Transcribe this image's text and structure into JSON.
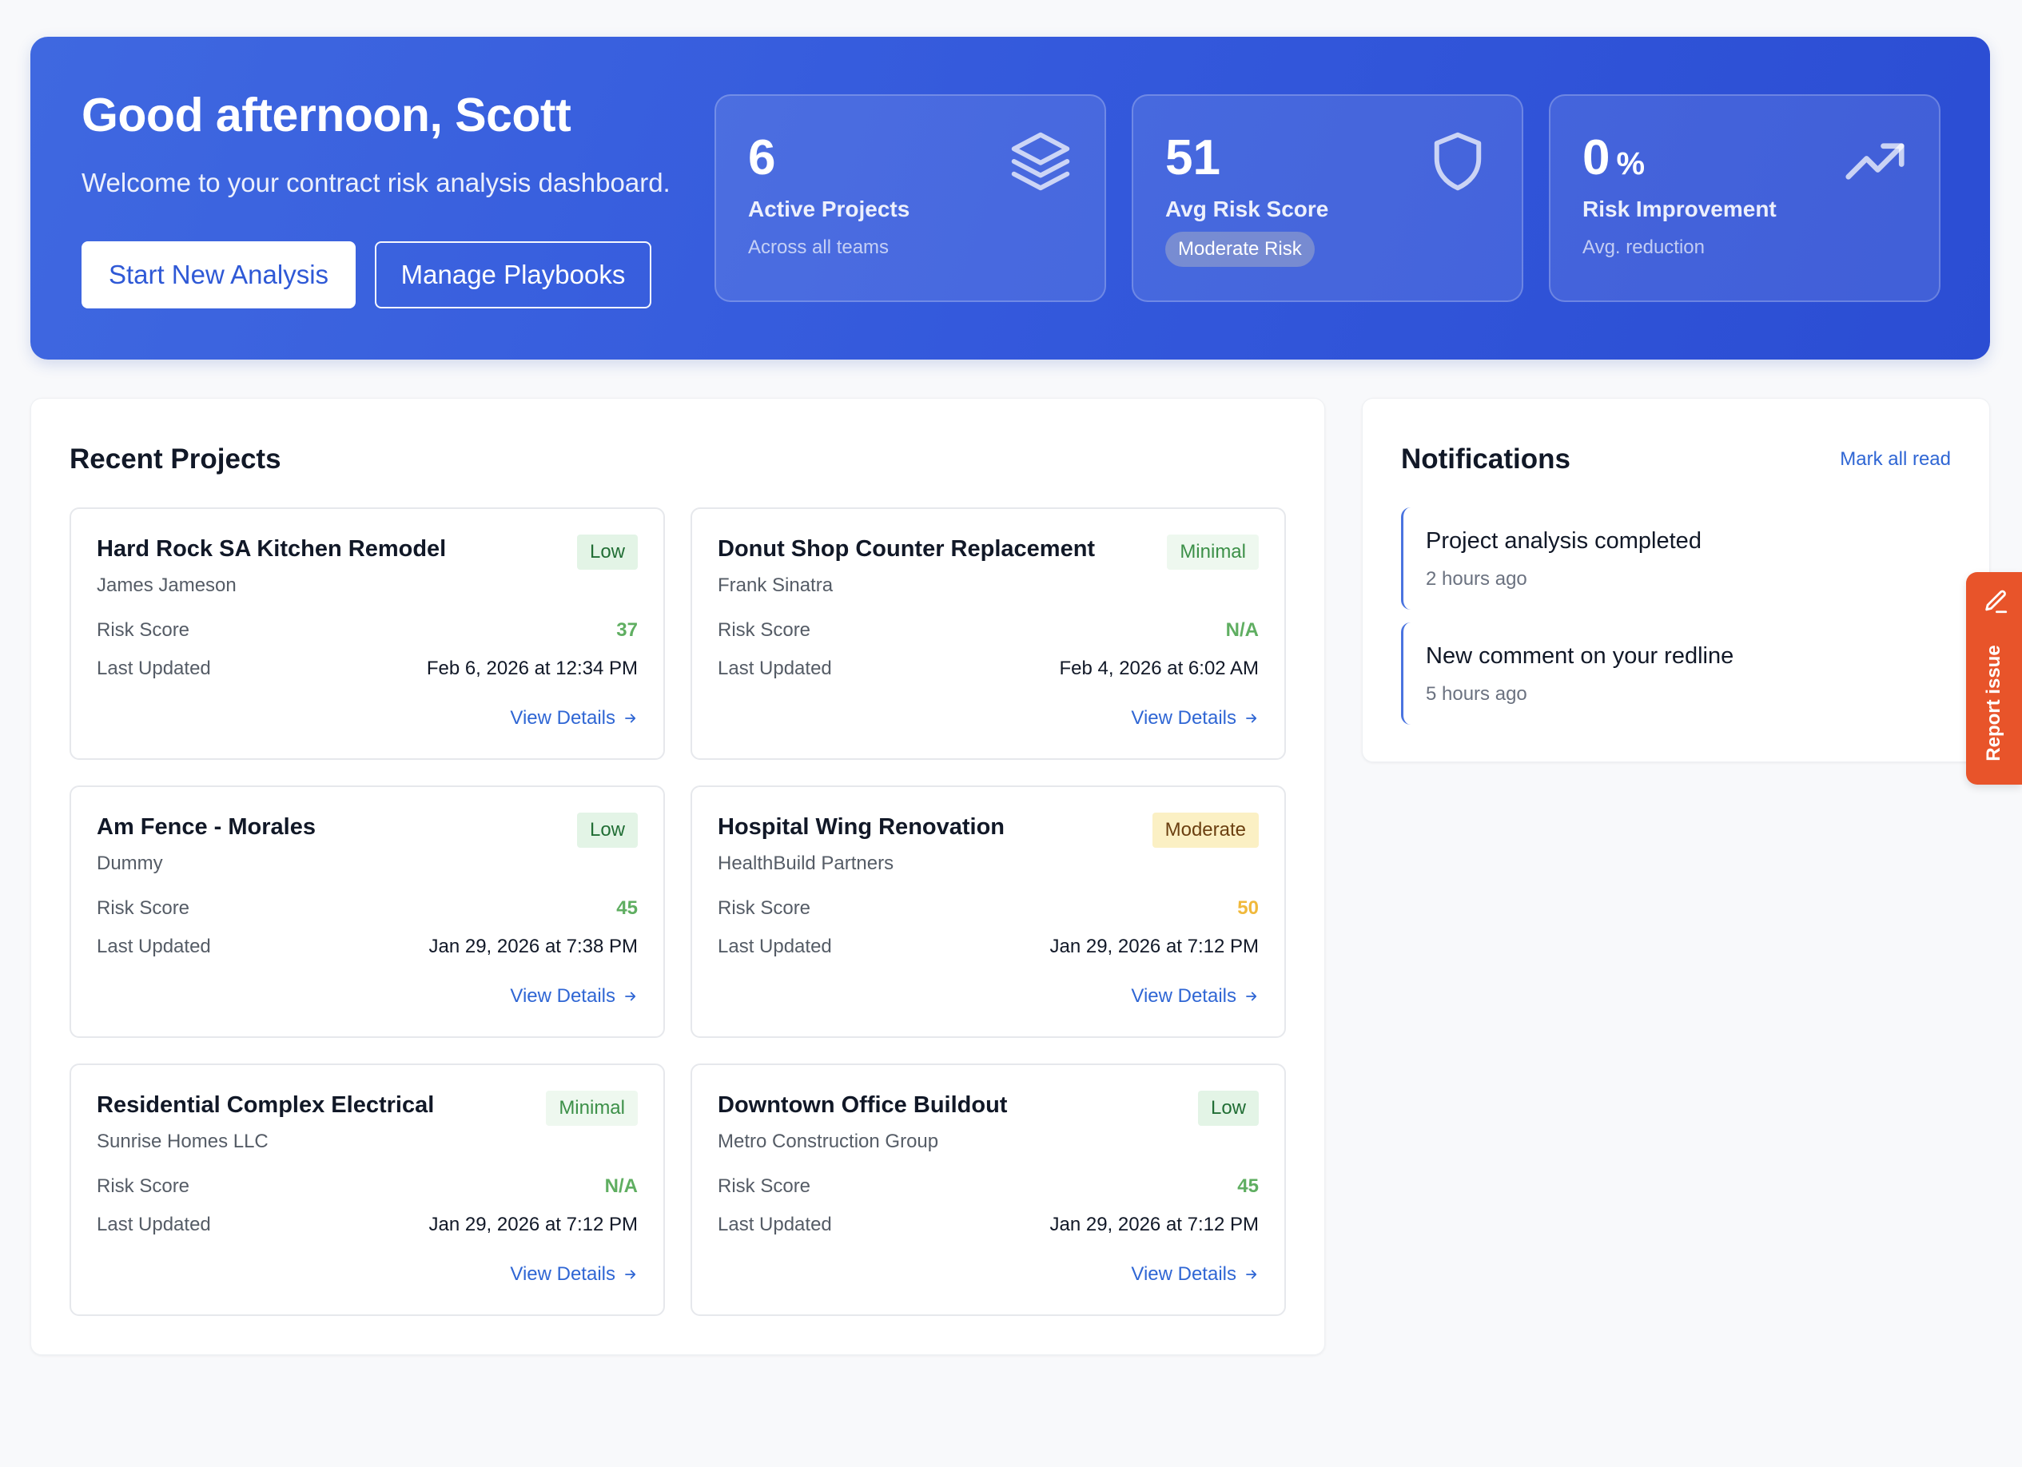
{
  "hero": {
    "greeting": "Good afternoon, Scott",
    "subtitle": "Welcome to your contract risk analysis dashboard.",
    "primary_button": "Start New Analysis",
    "secondary_button": "Manage Playbooks",
    "stats": [
      {
        "value": "6",
        "label": "Active Projects",
        "sub": "Across all teams",
        "icon": "layers-icon"
      },
      {
        "value": "51",
        "label": "Avg Risk Score",
        "badge": "Moderate Risk",
        "icon": "shield-icon"
      },
      {
        "value": "0",
        "unit": "%",
        "label": "Risk Improvement",
        "sub": "Avg. reduction",
        "icon": "trending-up-icon"
      }
    ]
  },
  "projects": {
    "title": "Recent Projects",
    "risk_label": "Risk Score",
    "updated_label": "Last Updated",
    "link_label": "View Details",
    "items": [
      {
        "name": "Hard Rock SA Kitchen Remodel",
        "client": "James Jameson",
        "badge": "Low",
        "score": "37",
        "updated": "Feb 6, 2026 at 12:34 PM"
      },
      {
        "name": "Donut Shop Counter Replacement",
        "client": "Frank Sinatra",
        "badge": "Minimal",
        "score": "N/A",
        "updated": "Feb 4, 2026 at 6:02 AM"
      },
      {
        "name": "Am Fence - Morales",
        "client": "Dummy",
        "badge": "Low",
        "score": "45",
        "updated": "Jan 29, 2026 at 7:38 PM"
      },
      {
        "name": "Hospital Wing Renovation",
        "client": "HealthBuild Partners",
        "badge": "Moderate",
        "score": "50",
        "updated": "Jan 29, 2026 at 7:12 PM"
      },
      {
        "name": "Residential Complex Electrical",
        "client": "Sunrise Homes LLC",
        "badge": "Minimal",
        "score": "N/A",
        "updated": "Jan 29, 2026 at 7:12 PM"
      },
      {
        "name": "Downtown Office Buildout",
        "client": "Metro Construction Group",
        "badge": "Low",
        "score": "45",
        "updated": "Jan 29, 2026 at 7:12 PM"
      }
    ]
  },
  "notifications": {
    "title": "Notifications",
    "mark_all": "Mark all read",
    "items": [
      {
        "title": "Project analysis completed",
        "time": "2 hours ago"
      },
      {
        "title": "New comment on your redline",
        "time": "5 hours ago"
      }
    ]
  },
  "report_tab": {
    "label": "Report issue",
    "icon": "pencil-icon"
  },
  "colors": {
    "accent": "#3459dc",
    "link": "#2f66d4",
    "report": "#e8542a",
    "score_green": "#5fae61",
    "score_amber": "#f0b93c"
  }
}
